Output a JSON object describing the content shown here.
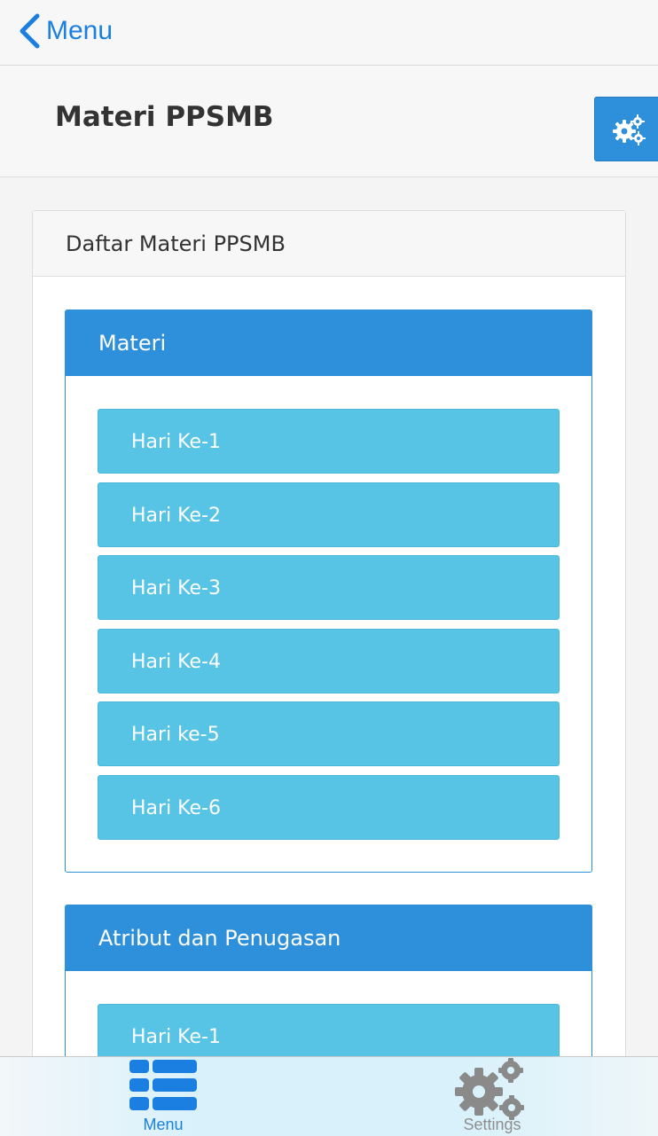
{
  "nav": {
    "back_label": "Menu"
  },
  "header": {
    "title": "Materi PPSMB",
    "settings_icon": "gears-icon"
  },
  "panel": {
    "heading": "Daftar Materi PPSMB",
    "sections": [
      {
        "heading": "Materi",
        "items": [
          "Hari Ke-1",
          "Hari Ke-2",
          "Hari Ke-3",
          "Hari Ke-4",
          "Hari ke-5",
          "Hari Ke-6"
        ]
      },
      {
        "heading": "Atribut dan Penugasan",
        "items": [
          "Hari Ke-1"
        ]
      }
    ]
  },
  "tabbar": {
    "tabs": [
      {
        "label": "Menu",
        "icon": "list-icon",
        "active": true
      },
      {
        "label": "Settings",
        "icon": "gears-icon",
        "active": false
      }
    ]
  },
  "colors": {
    "accent": "#2e8fdb",
    "item": "#57c3e5",
    "ios_blue": "#1a7fe0"
  }
}
